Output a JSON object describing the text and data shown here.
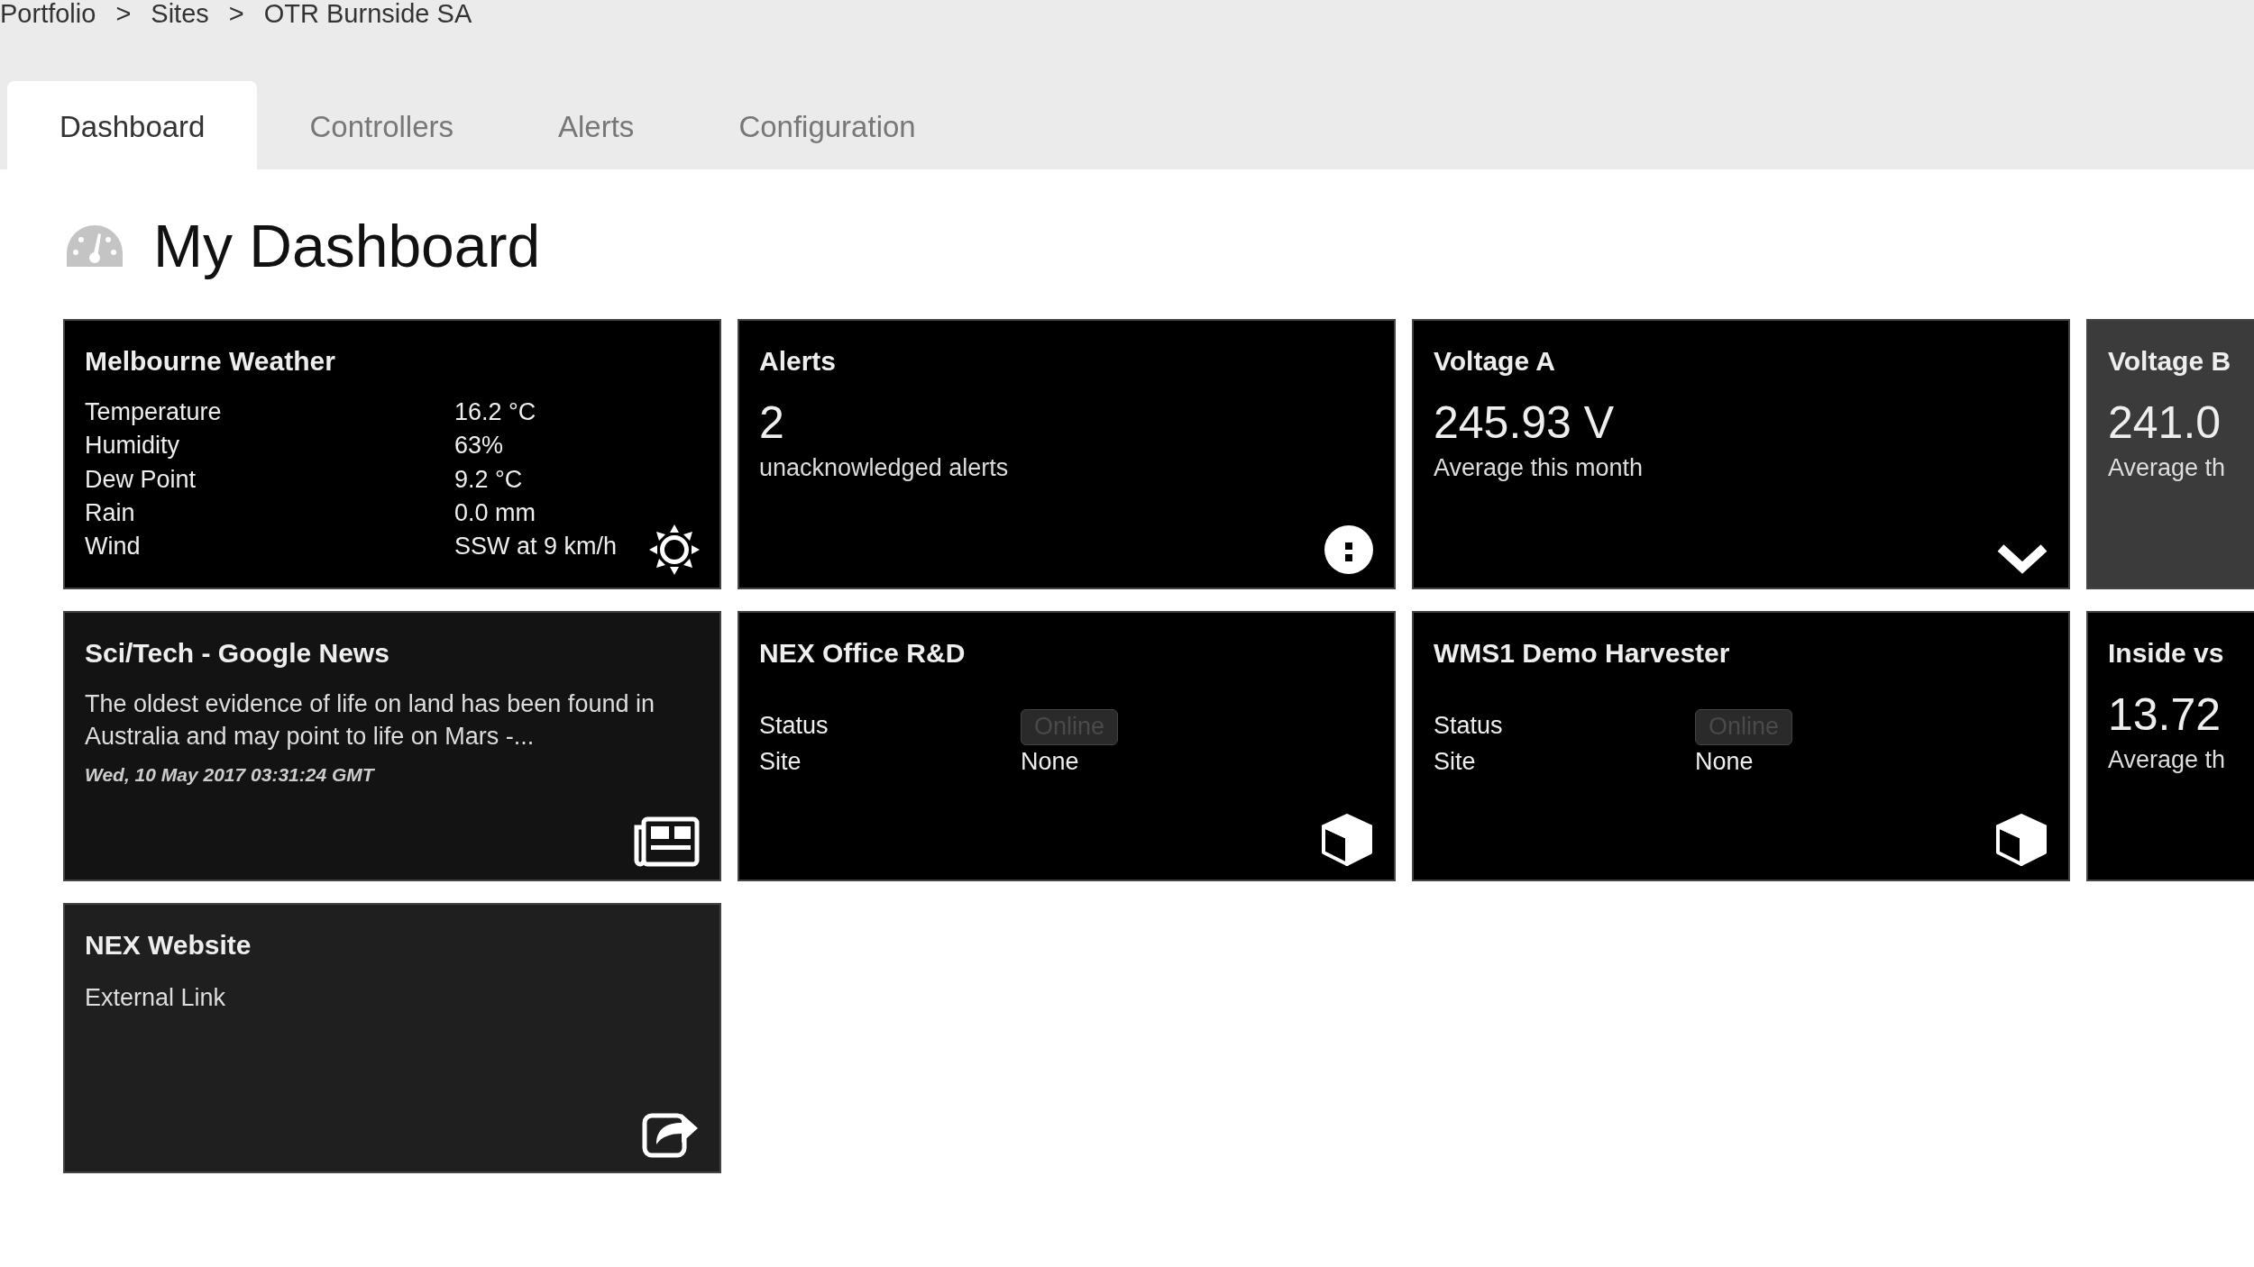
{
  "breadcrumb": [
    "Portfolio",
    ">",
    "Sites",
    ">",
    "OTR Burnside SA"
  ],
  "tabs": [
    {
      "label": "Dashboard",
      "selected": true
    },
    {
      "label": "Controllers",
      "selected": false
    },
    {
      "label": "Alerts",
      "selected": false
    },
    {
      "label": "Configuration",
      "selected": false
    }
  ],
  "page_title": "My Dashboard",
  "widgets": [
    {
      "kind": "weather",
      "title": "Melbourne Weather",
      "highlighted": false,
      "rows": [
        {
          "label": "Temperature",
          "value": "16.2 °C"
        },
        {
          "label": "Humidity",
          "value": "63%"
        },
        {
          "label": "Dew Point",
          "value": "9.2 °C"
        },
        {
          "label": "Rain",
          "value": "0.0 mm"
        },
        {
          "label": "Wind",
          "value": "SSW at 9 km/h"
        }
      ]
    },
    {
      "kind": "alerts",
      "title": "Alerts",
      "highlighted": false,
      "value": "2",
      "caption": "unacknowledged alerts"
    },
    {
      "kind": "meter",
      "title": "Voltage A",
      "highlighted": false,
      "value": "245.93 V",
      "caption": "Average this month"
    },
    {
      "kind": "summary",
      "title": "Voltage B",
      "highlighted": true,
      "value": "241.0",
      "caption": "Average th"
    },
    {
      "kind": "news",
      "title": "Sci/Tech - Google News",
      "highlighted": false,
      "text": "The oldest evidence of life on land has been found in Australia and may point to life on Mars -...",
      "date": "Wed, 10 May 2017 03:31:24 GMT"
    },
    {
      "kind": "device",
      "title": "NEX Office R&D",
      "highlighted": false,
      "rows": [
        {
          "label": "Status",
          "value": "Online",
          "badge": true
        },
        {
          "label": "Site",
          "value": "None",
          "badge": false
        }
      ]
    },
    {
      "kind": "device",
      "title": "WMS1 Demo Harvester",
      "highlighted": false,
      "rows": [
        {
          "label": "Status",
          "value": "Online",
          "badge": true
        },
        {
          "label": "Site",
          "value": "None",
          "badge": false
        }
      ]
    },
    {
      "kind": "summary",
      "title": "Inside vs",
      "highlighted": false,
      "value": "13.72",
      "caption": "Average th"
    },
    {
      "kind": "link",
      "title": "NEX Website",
      "highlighted": false,
      "caption": "External Link"
    }
  ]
}
